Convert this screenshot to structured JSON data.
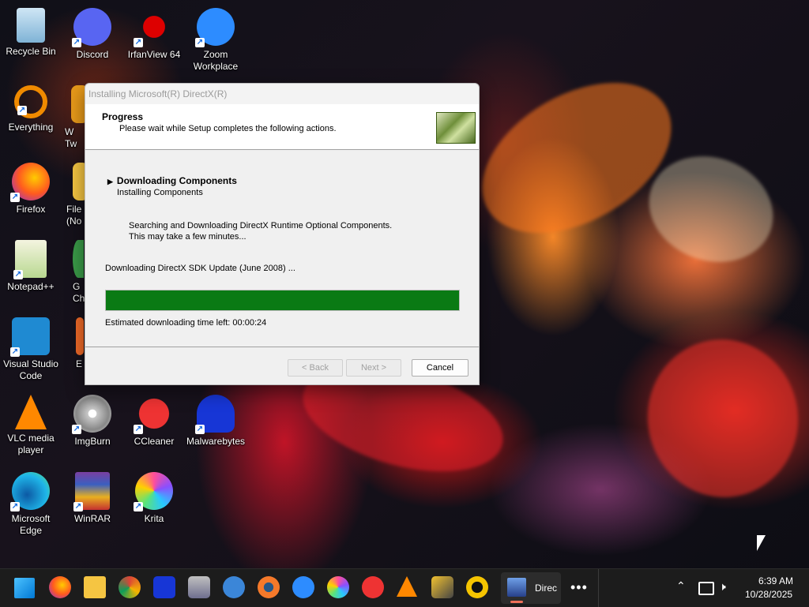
{
  "desktop": {
    "icons": [
      {
        "label": "Recycle Bin"
      },
      {
        "label": "Discord"
      },
      {
        "label": "IrfanView 64"
      },
      {
        "label": "Zoom Workplace"
      },
      {
        "label": "Everything"
      },
      {
        "label": "Firefox"
      },
      {
        "label": "Notepad++"
      },
      {
        "label": "Visual Studio Code"
      },
      {
        "label": "VLC media player"
      },
      {
        "label": "ImgBurn"
      },
      {
        "label": "CCleaner"
      },
      {
        "label": "Malwarebytes"
      },
      {
        "label": "Microsoft Edge"
      },
      {
        "label": "WinRAR"
      },
      {
        "label": "Krita"
      }
    ],
    "partial_labels": [
      "W",
      "Tw",
      "File",
      "(No",
      "G",
      "Ch",
      "E"
    ]
  },
  "dialog": {
    "title": "Installing Microsoft(R) DirectX(R)",
    "header_title": "Progress",
    "header_subtitle": "Please wait while Setup completes the following actions.",
    "step_current": "Downloading Components",
    "step_next": "Installing Components",
    "desc_line1": "Searching and Downloading DirectX Runtime Optional Components.",
    "desc_line2": "This may take a few minutes...",
    "downloading": "Downloading DirectX SDK Update (June 2008) ...",
    "progress": 1.0,
    "eta": "Estimated downloading time left: 00:00:24",
    "back_label": "< Back",
    "next_label": "Next >",
    "cancel_label": "Cancel"
  },
  "taskbar": {
    "active_app_label": "Direc",
    "time": "6:39 AM",
    "date": "10/28/2025"
  },
  "colors": {
    "progress_fill": "#0a7a14",
    "taskbar_bg": "#1c1c1c"
  }
}
